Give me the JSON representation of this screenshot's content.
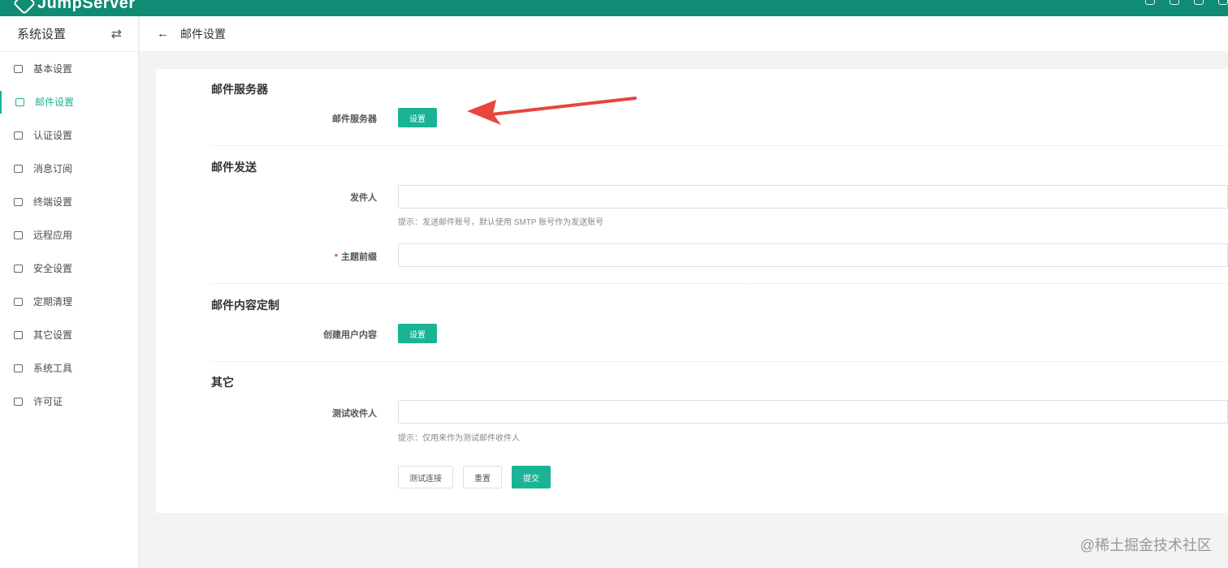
{
  "topbar": {
    "brand": "JumpServer",
    "icons": [
      "bell-icon",
      "message-icon",
      "settings-icon",
      "help-icon"
    ],
    "color": "#0f8c73"
  },
  "sidebar": {
    "title": "系统设置",
    "switch_icon": "swap-icon",
    "items": [
      {
        "label": "基本设置",
        "icon": "grid-icon",
        "active": false
      },
      {
        "label": "邮件设置",
        "icon": "mail-icon",
        "active": true
      },
      {
        "label": "认证设置",
        "icon": "id-card-icon",
        "active": false
      },
      {
        "label": "消息订阅",
        "icon": "bell-icon",
        "active": false
      },
      {
        "label": "终端设置",
        "icon": "terminal-icon",
        "active": false
      },
      {
        "label": "远程应用",
        "icon": "apps-icon",
        "active": false
      },
      {
        "label": "安全设置",
        "icon": "shield-icon",
        "active": false
      },
      {
        "label": "定期清理",
        "icon": "broom-icon",
        "active": false
      },
      {
        "label": "其它设置",
        "icon": "eye-icon",
        "active": false
      },
      {
        "label": "系统工具",
        "icon": "tools-icon",
        "active": false
      },
      {
        "label": "许可证",
        "icon": "diamond-icon",
        "active": false
      }
    ],
    "accent": "#1ab394"
  },
  "page": {
    "back_icon": "arrow-left-icon",
    "title": "邮件设置"
  },
  "form": {
    "section_server": {
      "title": "邮件服务器",
      "row_label": "邮件服务器",
      "button": "设置"
    },
    "section_send": {
      "title": "邮件发送",
      "sender_label": "发件人",
      "sender_value": "",
      "sender_hint": "提示：发送邮件账号，默认使用 SMTP 账号作为发送账号",
      "subject_required": "*",
      "subject_label": "主题前缀",
      "subject_value": ""
    },
    "section_content": {
      "title": "邮件内容定制",
      "row_label": "创建用户内容",
      "button": "设置"
    },
    "section_other": {
      "title": "其它",
      "recipient_label": "测试收件人",
      "recipient_value": "",
      "recipient_hint": "提示：仅用来作为测试邮件收件人"
    },
    "actions": {
      "test": "测试连接",
      "reset": "重置",
      "submit": "提交"
    }
  },
  "annotation": {
    "color": "#e8453c"
  },
  "watermark": "@稀土掘金技术社区"
}
